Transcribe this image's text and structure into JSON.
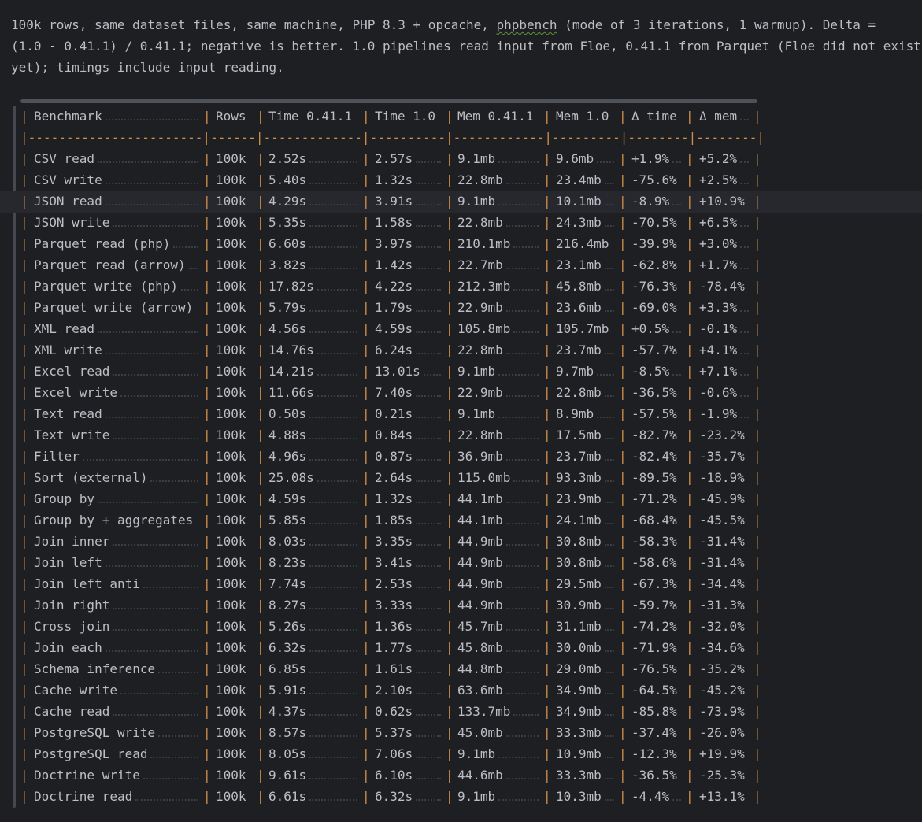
{
  "intro": {
    "line1": "100k rows, same dataset files, same machine, PHP 8.3 + opcache, ",
    "line1_spell": "phpbench",
    "line1_end": " (mode of 3 iterations, 1 warmup). Delta =",
    "line2": "(1.0 - 0.41.1) / 0.41.1; negative is better. 1.0 pipelines read input from Floe, 0.41.1 from Parquet (Floe did not exist",
    "line3": "yet); timings include input reading."
  },
  "table": {
    "headers": [
      "Benchmark",
      "Rows",
      "Time 0.41.1",
      "Time 1.0",
      "Mem 0.41.1",
      "Mem 1.0",
      "Δ time",
      "Δ mem"
    ],
    "separator": "|-----------------------|------|-------------|----------|------------|---------|--------|--------|",
    "rows": [
      [
        "CSV read",
        "100k",
        "2.52s",
        "2.57s",
        "9.1mb",
        "9.6mb",
        "+1.9%",
        "+5.2%"
      ],
      [
        "CSV write",
        "100k",
        "5.40s",
        "1.32s",
        "22.8mb",
        "23.4mb",
        "-75.6%",
        "+2.5%"
      ],
      [
        "JSON read",
        "100k",
        "4.29s",
        "3.91s",
        "9.1mb",
        "10.1mb",
        "-8.9%",
        "+10.9%"
      ],
      [
        "JSON write",
        "100k",
        "5.35s",
        "1.58s",
        "22.8mb",
        "24.3mb",
        "-70.5%",
        "+6.5%"
      ],
      [
        "Parquet read (php)",
        "100k",
        "6.60s",
        "3.97s",
        "210.1mb",
        "216.4mb",
        "-39.9%",
        "+3.0%"
      ],
      [
        "Parquet read (arrow)",
        "100k",
        "3.82s",
        "1.42s",
        "22.7mb",
        "23.1mb",
        "-62.8%",
        "+1.7%"
      ],
      [
        "Parquet write (php)",
        "100k",
        "17.82s",
        "4.22s",
        "212.3mb",
        "45.8mb",
        "-76.3%",
        "-78.4%"
      ],
      [
        "Parquet write (arrow)",
        "100k",
        "5.79s",
        "1.79s",
        "22.9mb",
        "23.6mb",
        "-69.0%",
        "+3.3%"
      ],
      [
        "XML read",
        "100k",
        "4.56s",
        "4.59s",
        "105.8mb",
        "105.7mb",
        "+0.5%",
        "-0.1%"
      ],
      [
        "XML write",
        "100k",
        "14.76s",
        "6.24s",
        "22.8mb",
        "23.7mb",
        "-57.7%",
        "+4.1%"
      ],
      [
        "Excel read",
        "100k",
        "14.21s",
        "13.01s",
        "9.1mb",
        "9.7mb",
        "-8.5%",
        "+7.1%"
      ],
      [
        "Excel write",
        "100k",
        "11.66s",
        "7.40s",
        "22.9mb",
        "22.8mb",
        "-36.5%",
        "-0.6%"
      ],
      [
        "Text read",
        "100k",
        "0.50s",
        "0.21s",
        "9.1mb",
        "8.9mb",
        "-57.5%",
        "-1.9%"
      ],
      [
        "Text write",
        "100k",
        "4.88s",
        "0.84s",
        "22.8mb",
        "17.5mb",
        "-82.7%",
        "-23.2%"
      ],
      [
        "Filter",
        "100k",
        "4.96s",
        "0.87s",
        "36.9mb",
        "23.7mb",
        "-82.4%",
        "-35.7%"
      ],
      [
        "Sort (external)",
        "100k",
        "25.08s",
        "2.64s",
        "115.0mb",
        "93.3mb",
        "-89.5%",
        "-18.9%"
      ],
      [
        "Group by",
        "100k",
        "4.59s",
        "1.32s",
        "44.1mb",
        "23.9mb",
        "-71.2%",
        "-45.9%"
      ],
      [
        "Group by + aggregates",
        "100k",
        "5.85s",
        "1.85s",
        "44.1mb",
        "24.1mb",
        "-68.4%",
        "-45.5%"
      ],
      [
        "Join inner",
        "100k",
        "8.03s",
        "3.35s",
        "44.9mb",
        "30.8mb",
        "-58.3%",
        "-31.4%"
      ],
      [
        "Join left",
        "100k",
        "8.23s",
        "3.41s",
        "44.9mb",
        "30.8mb",
        "-58.6%",
        "-31.4%"
      ],
      [
        "Join left anti",
        "100k",
        "7.74s",
        "2.53s",
        "44.9mb",
        "29.5mb",
        "-67.3%",
        "-34.4%"
      ],
      [
        "Join right",
        "100k",
        "8.27s",
        "3.33s",
        "44.9mb",
        "30.9mb",
        "-59.7%",
        "-31.3%"
      ],
      [
        "Cross join",
        "100k",
        "5.26s",
        "1.36s",
        "45.7mb",
        "31.1mb",
        "-74.2%",
        "-32.0%"
      ],
      [
        "Join each",
        "100k",
        "6.32s",
        "1.77s",
        "45.8mb",
        "30.0mb",
        "-71.9%",
        "-34.6%"
      ],
      [
        "Schema inference",
        "100k",
        "6.85s",
        "1.61s",
        "44.8mb",
        "29.0mb",
        "-76.5%",
        "-35.2%"
      ],
      [
        "Cache write",
        "100k",
        "5.91s",
        "2.10s",
        "63.6mb",
        "34.9mb",
        "-64.5%",
        "-45.2%"
      ],
      [
        "Cache read",
        "100k",
        "4.37s",
        "0.62s",
        "133.7mb",
        "34.9mb",
        "-85.8%",
        "-73.9%"
      ],
      [
        "PostgreSQL write",
        "100k",
        "8.57s",
        "5.37s",
        "45.0mb",
        "33.3mb",
        "-37.4%",
        "-26.0%"
      ],
      [
        "PostgreSQL read",
        "100k",
        "8.05s",
        "7.06s",
        "9.1mb",
        "10.9mb",
        "-12.3%",
        "+19.9%"
      ],
      [
        "Doctrine write",
        "100k",
        "9.61s",
        "6.10s",
        "44.6mb",
        "33.3mb",
        "-36.5%",
        "-25.3%"
      ],
      [
        "Doctrine read",
        "100k",
        "6.61s",
        "6.32s",
        "9.1mb",
        "10.3mb",
        "-4.4%",
        "+13.1%"
      ]
    ]
  }
}
